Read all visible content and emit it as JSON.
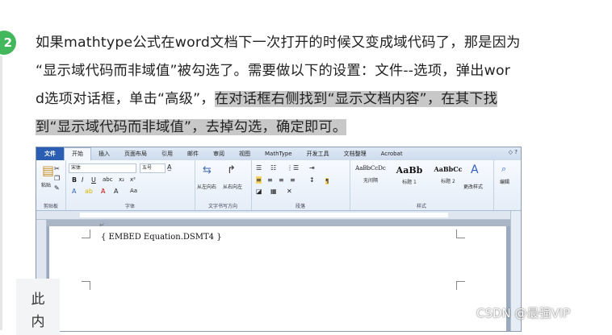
{
  "step": {
    "number": "2"
  },
  "paragraph": {
    "line1": "如果mathtype公式在word文档下一次打开的时候又变成域代码了，那是因为",
    "line2": "“显示域代码而非域值”被勾选了。需要做以下的设置：文件--选项，弹出wor",
    "line3_plain": "d选项对话框，单击“高级”，",
    "line3_highlight": "在对话框右侧找到“显示文档内容”，在其下找",
    "line4_highlight": "到“显示域代码而非域值”，去掉勾选，确定即可。"
  },
  "word": {
    "tabs": [
      "文件",
      "开始",
      "插入",
      "页面布局",
      "引用",
      "邮件",
      "审阅",
      "视图",
      "MathType",
      "开发工具",
      "文档整理",
      "Acrobat"
    ],
    "active_tab_index": 1,
    "ribbon": {
      "clipboard_label": "剪贴板",
      "paste_label": "粘贴",
      "font_name": "宋体",
      "font_size": "五号",
      "font_label": "字体",
      "direction_label": "文字书写方向",
      "ltr_label": "从左向右",
      "rtl_label": "从右向左",
      "paragraph_label": "段落",
      "styles_label": "样式",
      "styles": [
        {
          "sample": "AaBbCcDc",
          "name": "无间隔"
        },
        {
          "sample": "AaBb",
          "name": "标题 1"
        },
        {
          "sample": "AaBbCc",
          "name": "标题 2"
        }
      ],
      "change_styles_label": "更改样式",
      "editing_label": "编辑"
    },
    "field_code": "{ EMBED Equation.DSMT4 }"
  },
  "side_tab": {
    "line1": "此",
    "line2": "内"
  },
  "watermark": "CSDN @最强VIP"
}
